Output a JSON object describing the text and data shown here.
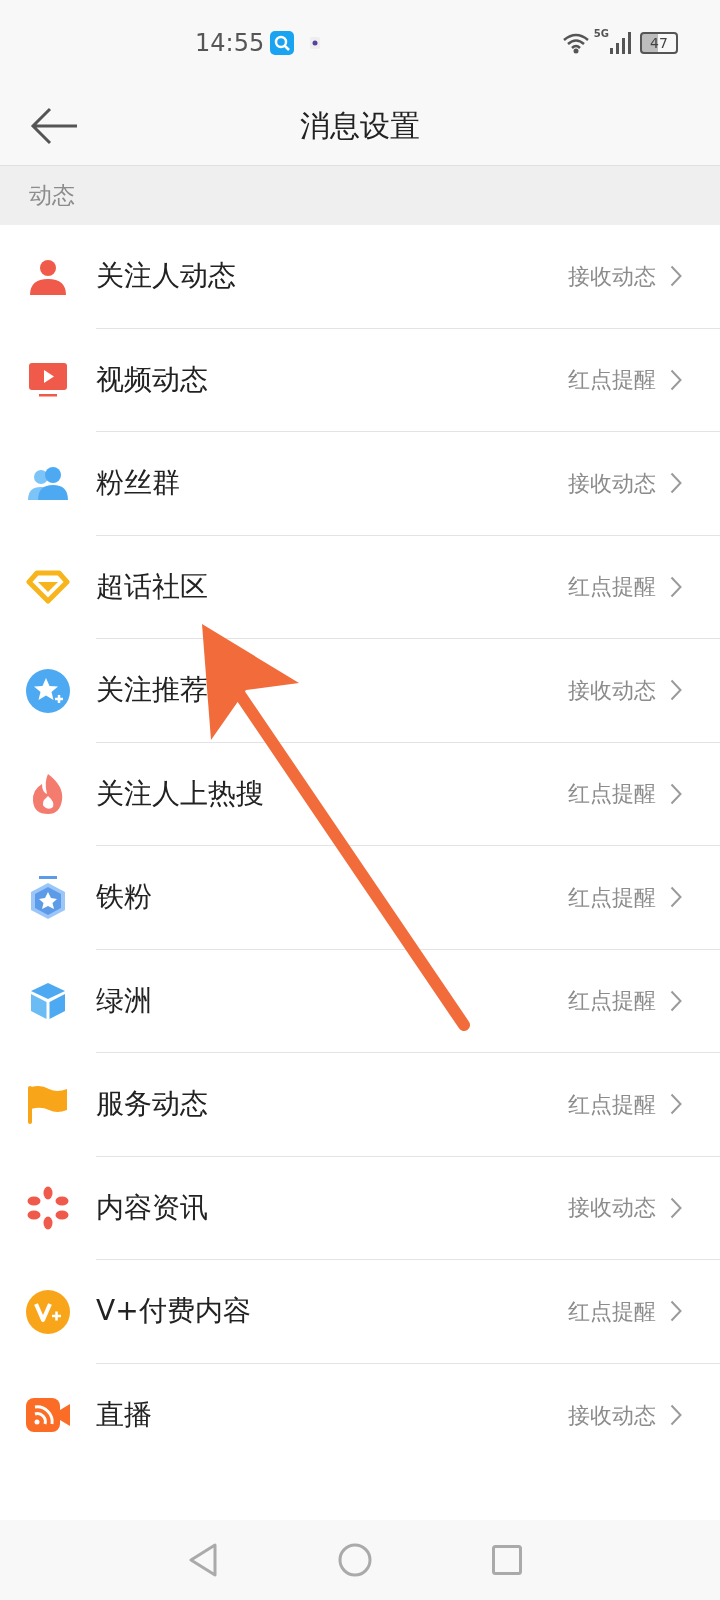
{
  "status_bar": {
    "time": "14:55",
    "network": "5G",
    "battery": "47"
  },
  "header": {
    "title": "消息设置"
  },
  "section": {
    "title": "动态"
  },
  "rows": [
    {
      "label": "关注人动态",
      "value": "接收动态"
    },
    {
      "label": "视频动态",
      "value": "红点提醒"
    },
    {
      "label": "粉丝群",
      "value": "接收动态"
    },
    {
      "label": "超话社区",
      "value": "红点提醒"
    },
    {
      "label": "关注推荐",
      "value": "接收动态"
    },
    {
      "label": "关注人上热搜",
      "value": "红点提醒"
    },
    {
      "label": "铁粉",
      "value": "红点提醒"
    },
    {
      "label": "绿洲",
      "value": "红点提醒"
    },
    {
      "label": "服务动态",
      "value": "红点提醒"
    },
    {
      "label": "内容资讯",
      "value": "接收动态"
    },
    {
      "label": "V+付费内容",
      "value": "红点提醒"
    },
    {
      "label": "直播",
      "value": "接收动态"
    }
  ]
}
